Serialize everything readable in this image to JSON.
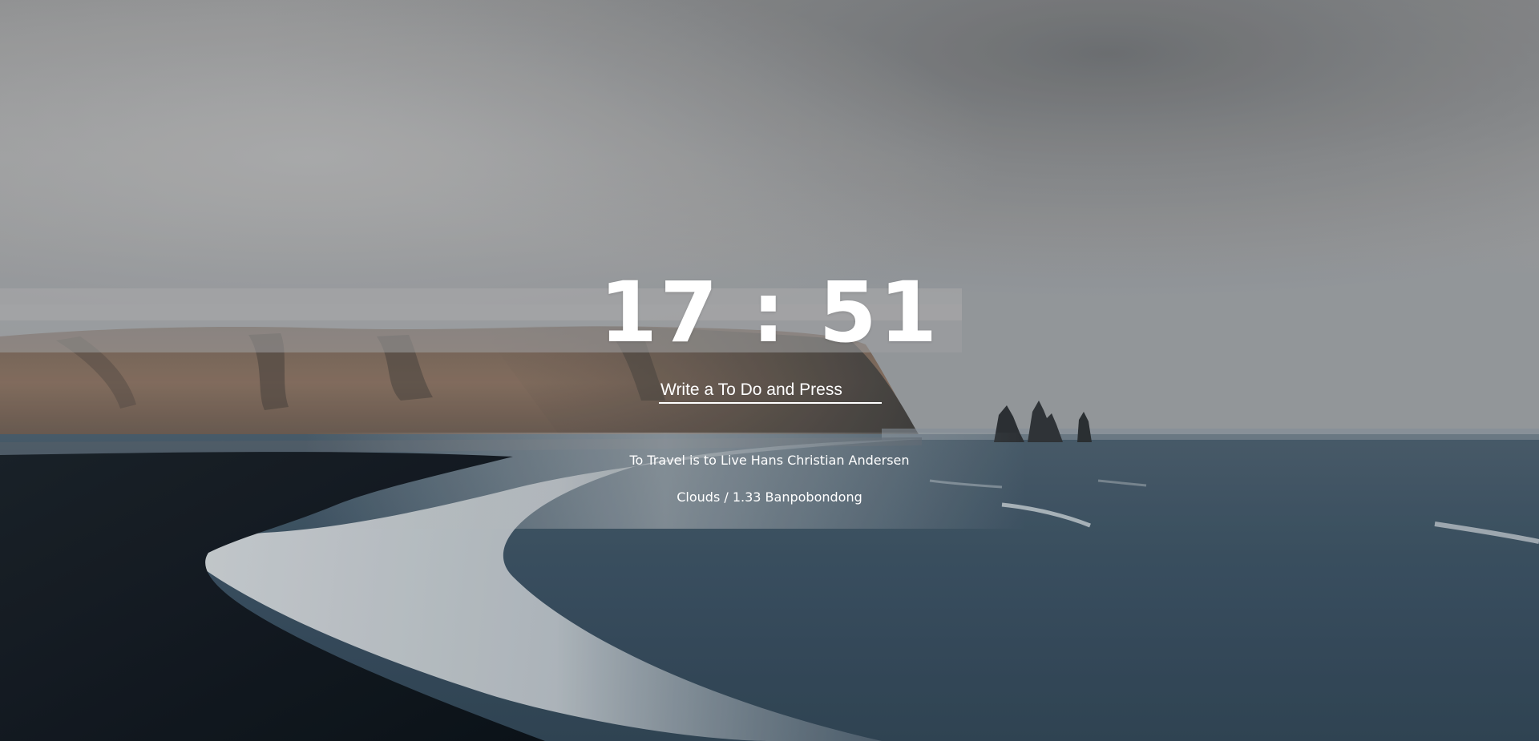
{
  "background": {
    "description_colors": {
      "sky_top": "#8b8c8e",
      "fog": "#b2b3b4",
      "cliff": "#8a7464",
      "sea": "#3b5263",
      "sand": "#121a22",
      "surf": "#dfe3e6"
    }
  },
  "clock": {
    "hours": "17",
    "separator": ":",
    "minutes": "51"
  },
  "todo": {
    "placeholder": "Write a To Do and Press",
    "value": ""
  },
  "quote": {
    "text": "To Travel is to Live",
    "author": "Hans Christian Andersen"
  },
  "weather": {
    "text": "Clouds / 1.33 Banpobondong"
  }
}
